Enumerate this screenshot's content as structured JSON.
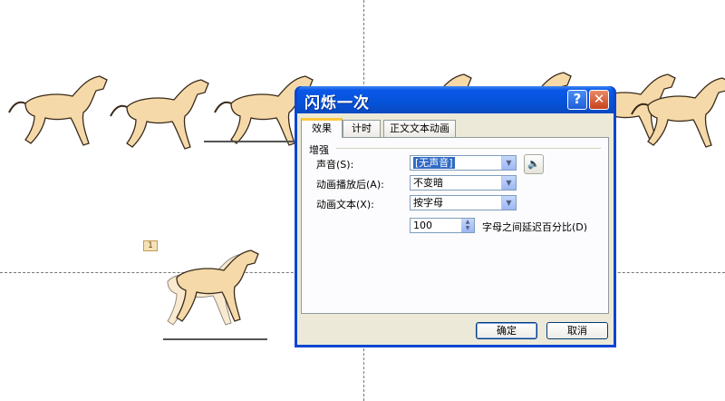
{
  "colors": {
    "horse_fill": "#f5d9a8",
    "horse_line": "#3a2a1a",
    "title_bar": "#0a58e8",
    "dialog_face": "#ece9d8"
  },
  "slide": {
    "animation_marker": "1"
  },
  "dialog": {
    "title": "闪烁一次",
    "help_label": "?",
    "close_label": "✕",
    "tabs": [
      {
        "label": "效果",
        "active": true
      },
      {
        "label": "计时",
        "active": false
      },
      {
        "label": "正文文本动画",
        "active": false
      }
    ],
    "section_title": "增强",
    "fields": {
      "sound": {
        "label": "声音(S):",
        "value": "[无声音]"
      },
      "after_animation": {
        "label": "动画播放后(A):",
        "value": "不变暗"
      },
      "animate_text": {
        "label": "动画文本(X):",
        "value": "按字母"
      },
      "delay": {
        "value": "100",
        "suffix": "字母之间延迟百分比(D)"
      }
    },
    "icons": {
      "sound": "speaker-icon",
      "combo_arrow": "chevron-down-icon",
      "spinner": "spinner-arrows-icon"
    },
    "buttons": {
      "ok": "确定",
      "cancel": "取消"
    }
  }
}
